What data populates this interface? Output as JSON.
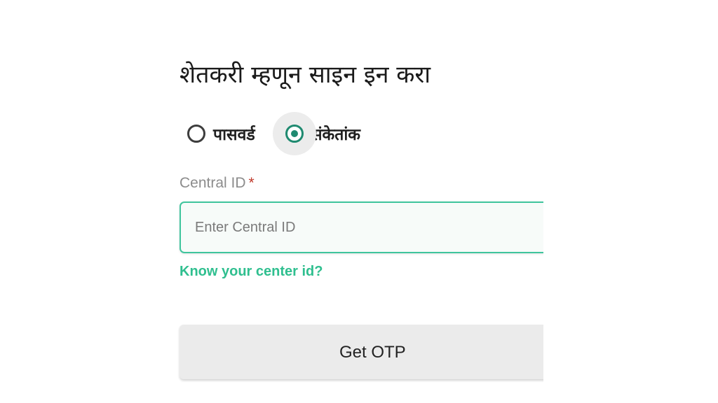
{
  "login": {
    "title": "शेतकरी म्हणून साइन इन करा",
    "methods": [
      {
        "label": "पासवर्ड",
        "selected": false
      },
      {
        "label": "संकेतांक",
        "selected": true
      }
    ],
    "central_id": {
      "label": "Central ID",
      "required_mark": "*",
      "value": "",
      "placeholder": "Enter Central ID"
    },
    "help_link": "Know your center id?",
    "submit_label": "Get OTP"
  },
  "colors": {
    "accent": "#1f8a70",
    "link": "#2fbf8f",
    "input_border": "#3fc59d",
    "required": "#c0392b",
    "button_bg": "#ebebeb"
  },
  "icons": {
    "radio_unchecked": "radio-unchecked-icon",
    "radio_checked": "radio-checked-icon"
  }
}
